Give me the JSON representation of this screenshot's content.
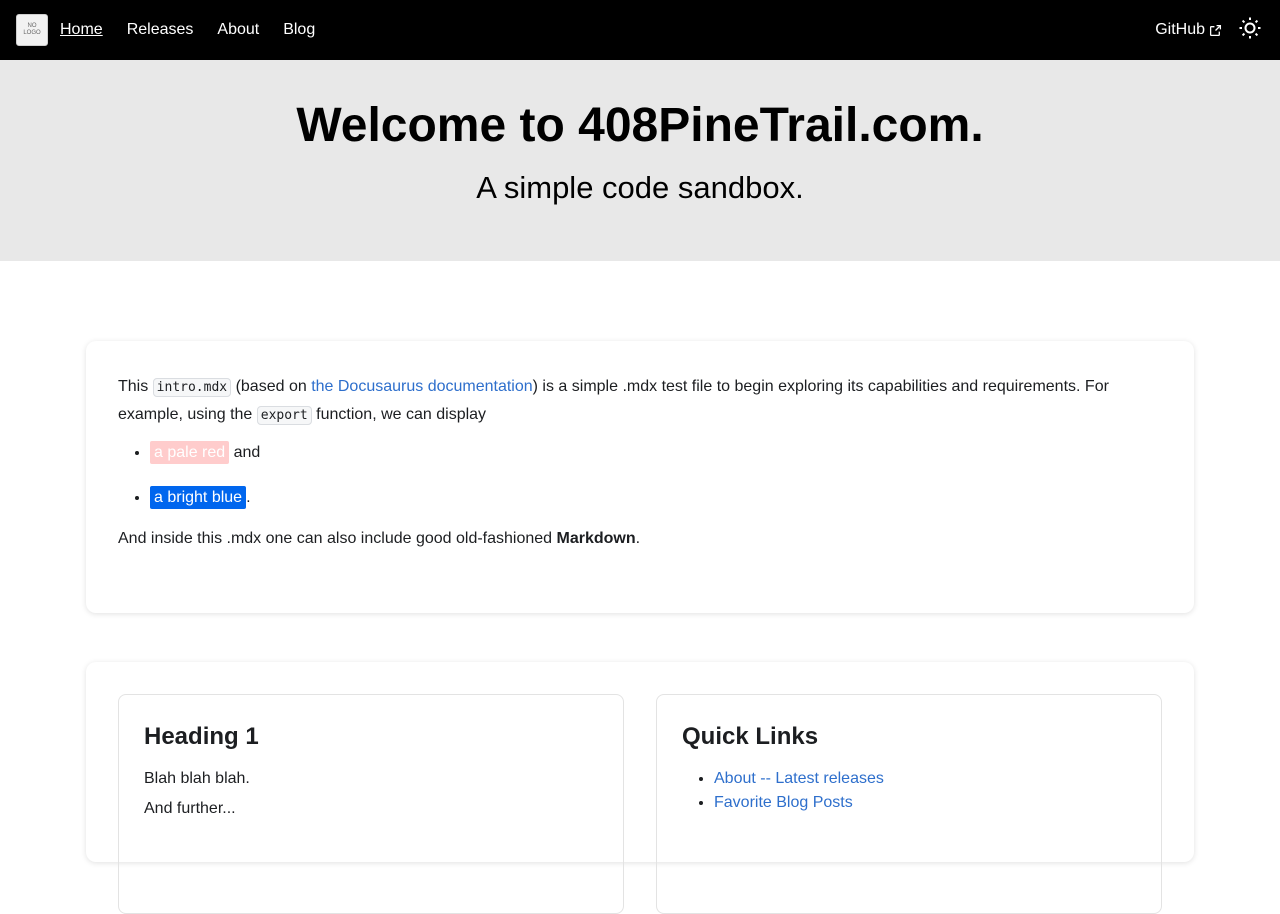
{
  "navbar": {
    "logo_line1": "NO",
    "logo_line2": "LOGO",
    "links": [
      {
        "label": "Home",
        "active": true
      },
      {
        "label": "Releases"
      },
      {
        "label": "About"
      },
      {
        "label": "Blog"
      }
    ],
    "github_label": "GitHub"
  },
  "hero": {
    "title": "Welcome to 408PineTrail.com.",
    "subtitle": "A simple code sandbox."
  },
  "intro": {
    "p1_a": "This ",
    "code1": "intro.mdx",
    "p1_b": " (based on ",
    "link": "the Docusaurus documentation",
    "p1_c": ") is a simple .mdx test file to begin exploring its capabilities and requirements. For example, using the ",
    "code2": "export",
    "p1_d": " function, we can display",
    "item1_highlight": "a pale red",
    "item1_suffix": " and",
    "item2_highlight": "a bright blue",
    "item2_suffix": ".",
    "p2_a": "And inside this .mdx one can also include good old-fashioned ",
    "p2_bold": "Markdown",
    "p2_b": "."
  },
  "bottom": {
    "left": {
      "heading": "Heading 1",
      "text1": "Blah blah blah.",
      "text2": "And further..."
    },
    "right": {
      "heading": "Quick Links",
      "links": [
        "About -- Latest releases",
        "Favorite Blog Posts"
      ]
    }
  },
  "colors": {
    "navbar_bg": "#000000",
    "hero_bg": "#e8e8e8",
    "link": "#2e6fcc",
    "pale_red": "#ffcccc",
    "bright_blue": "#0066ee"
  }
}
